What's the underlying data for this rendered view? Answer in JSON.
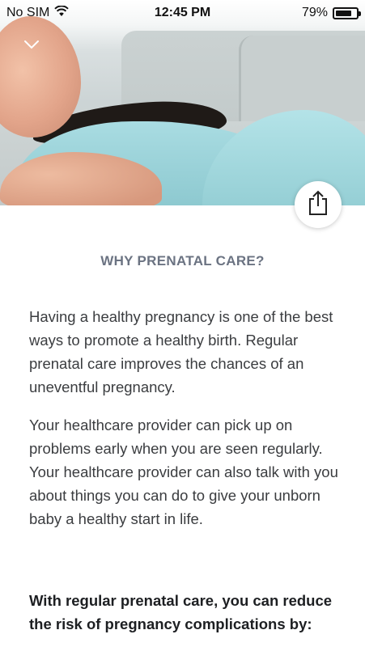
{
  "status_bar": {
    "carrier": "No SIM",
    "time": "12:45 PM",
    "battery": "79%",
    "battery_level": 0.79
  },
  "hero": {
    "icons": [
      "chevron-down-icon",
      "share-icon"
    ]
  },
  "article": {
    "title": "WHY PRENATAL CARE?",
    "paragraphs": [
      "Having a healthy pregnancy is one of the best ways to promote a healthy birth. Regular prenatal care improves the chances of an uneventful pregnancy.",
      "Your healthcare provider can pick up on problems early when you are seen regularly. Your healthcare provider can also talk with you about things you can do to give your unborn baby a healthy start in life."
    ],
    "lead": "With regular prenatal care, you can reduce the risk of pregnancy complications by:"
  }
}
